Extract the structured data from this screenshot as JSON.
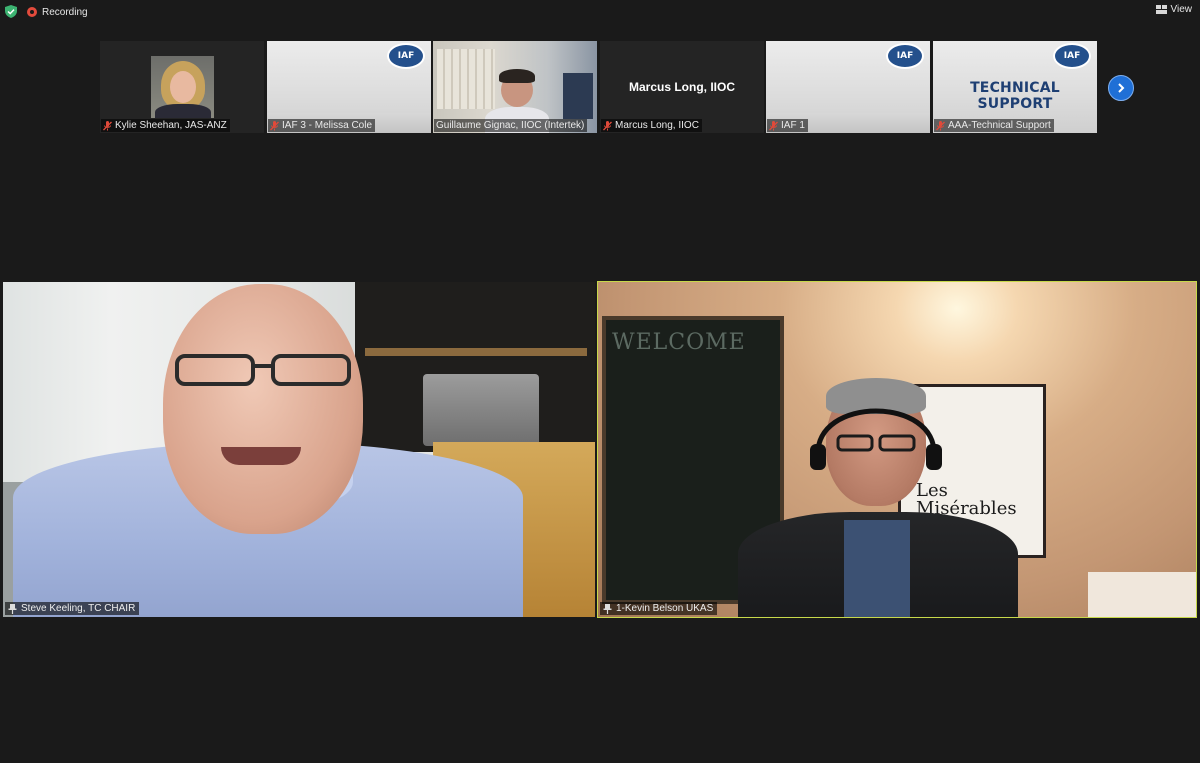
{
  "topbar": {
    "recording_label": "Recording",
    "view_label": "View",
    "colors": {
      "recording": "#e34b3c",
      "shield": "#3cb371"
    }
  },
  "thumbnails": [
    {
      "name": "Kylie Sheehan, JAS-ANZ",
      "muted": true,
      "kind": "video"
    },
    {
      "name": "IAF 3 - Melissa Cole",
      "muted": true,
      "kind": "iaf-logo"
    },
    {
      "name": "Guillaume Gignac, IIOC (Intertek)",
      "muted": false,
      "kind": "video"
    },
    {
      "name": "Marcus Long, IIOC",
      "muted": true,
      "kind": "name-card",
      "card_text": "Marcus Long, IIOC"
    },
    {
      "name": "IAF 1",
      "muted": true,
      "kind": "iaf-logo"
    },
    {
      "name": "AAA-Technical Support",
      "muted": true,
      "kind": "iaf-logo",
      "card_text": "TECHNICAL SUPPORT"
    }
  ],
  "iaf_logo_text": "IAF",
  "main": {
    "left": {
      "name": "Steve Keeling, TC CHAIR",
      "pinned": true
    },
    "right": {
      "name": "1-Kevin Belson UKAS",
      "pinned": true,
      "active_speaker": true,
      "board_text": "WELCOME",
      "poster_text_1": "Les",
      "poster_text_2": "Misérables"
    }
  },
  "colors": {
    "active_speaker_border": "#c7d84a",
    "next_button": "#1f6fd6",
    "background": "#1a1a1a"
  }
}
